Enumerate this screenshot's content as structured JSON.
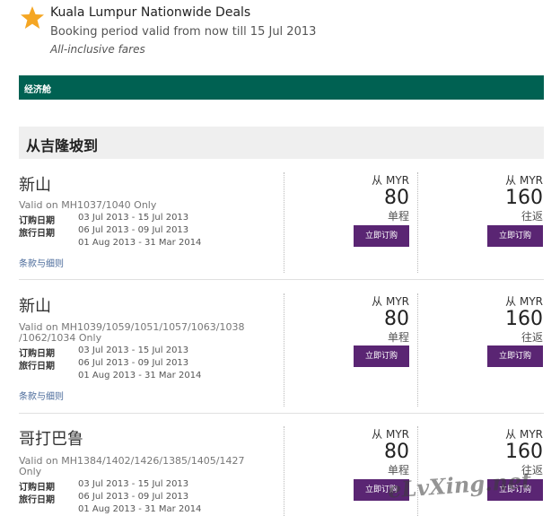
{
  "header": {
    "star_icon": "star-icon",
    "title": "Kuala Lumpur Nationwide Deals",
    "period": "Booking period valid from now till 15 Jul 2013",
    "note": "All-inclusive fares"
  },
  "class_bar": {
    "label": "经济舱",
    "color": "#006152"
  },
  "section": {
    "title": "从吉隆坡到"
  },
  "deals": [
    {
      "destination": "新山",
      "valid": "Valid on MH1037/1040 Only",
      "purchase_label": "订购日期",
      "purchase_dates": "03 Jul 2013 - 15 Jul 2013",
      "travel_label": "旅行日期",
      "travel_dates_1": "06 Jul 2013 - 09 Jul 2013",
      "travel_dates_2": "01 Aug 2013 - 31 Mar 2014",
      "terms": "条款与细则",
      "oneway": {
        "from": "从 MYR",
        "amount": "80",
        "trip": "单程",
        "button": "立即订购"
      },
      "return": {
        "from": "从 MYR",
        "amount": "160",
        "trip": "往返",
        "button": "立即订购"
      }
    },
    {
      "destination": "新山",
      "valid": "Valid on MH1039/1059/1051/1057/1063/1038 /1062/1034 Only",
      "purchase_label": "订购日期",
      "purchase_dates": "03 Jul 2013 - 15 Jul 2013",
      "travel_label": "旅行日期",
      "travel_dates_1": "06 Jul 2013 - 09 Jul 2013",
      "travel_dates_2": "01 Aug 2013 - 31 Mar 2014",
      "terms": "条款与细则",
      "oneway": {
        "from": "从 MYR",
        "amount": "80",
        "trip": "单程",
        "button": "立即订购"
      },
      "return": {
        "from": "从 MYR",
        "amount": "160",
        "trip": "往返",
        "button": "立即订购"
      }
    },
    {
      "destination": "哥打巴鲁",
      "valid": "Valid on MH1384/1402/1426/1385/1405/1427 Only",
      "purchase_label": "订购日期",
      "purchase_dates": "03 Jul 2013 - 15 Jul 2013",
      "travel_label": "旅行日期",
      "travel_dates_1": "06 Jul 2013 - 09 Jul 2013",
      "travel_dates_2": "01 Aug 2013 - 31 Mar 2014",
      "terms": "",
      "oneway": {
        "from": "从 MYR",
        "amount": "80",
        "trip": "单程",
        "button": "立即订购"
      },
      "return": {
        "from": "从 MYR",
        "amount": "160",
        "trip": "往返",
        "button": "立即订购"
      }
    }
  ],
  "watermark": "eLvXing.net",
  "colors": {
    "book_button": "#5a2573",
    "star": "#f5a623"
  }
}
